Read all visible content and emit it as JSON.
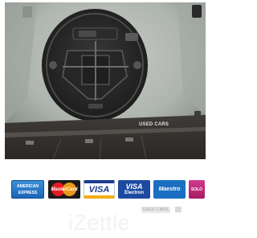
{
  "photo": {
    "subject": "spare-wheel-well-tool-kit",
    "watermark": "USED CARS"
  },
  "payment_cards": [
    {
      "name": "American Express",
      "label": "AMERICAN EXPRESS"
    },
    {
      "name": "MasterCard",
      "label": "MasterCard"
    },
    {
      "name": "Visa",
      "label": "VISA"
    },
    {
      "name": "Visa Electron",
      "label_top": "VISA",
      "label_bottom": "Electron"
    },
    {
      "name": "Maestro",
      "label": "Maestro"
    },
    {
      "name": "Solo",
      "label": "SOLO"
    }
  ],
  "footer": {
    "used_cars": "USED CARS",
    "brand": "iZettle"
  },
  "colors": {
    "amex": "#1b66b8",
    "mastercard_red": "#e51b24",
    "mastercard_orange": "#f6a01a",
    "visa_blue": "#1a3a8f",
    "visa_gold": "#f2ae14",
    "maestro": "#1a6fc2",
    "solo": "#c2287a"
  }
}
